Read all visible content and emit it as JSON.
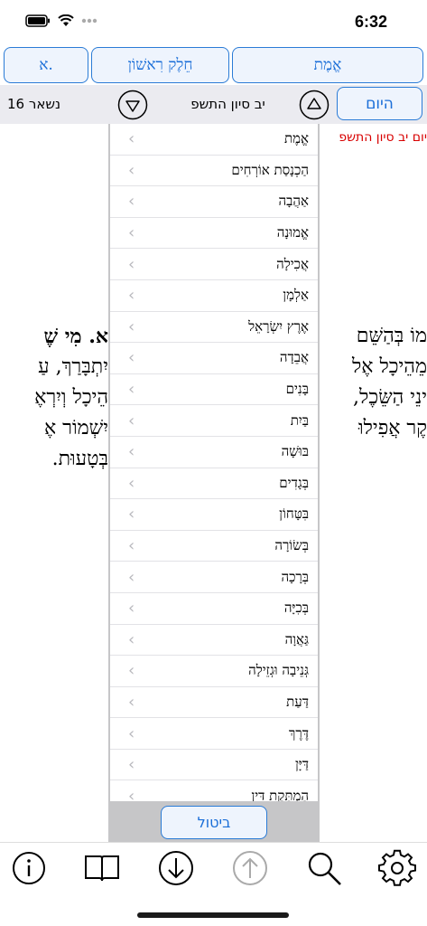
{
  "status": {
    "time": "6:32"
  },
  "top_buttons": {
    "emet": "אֱמֶת",
    "part": "חֵלֶק רִאשׁוֹן",
    "alef": "א."
  },
  "date_row": {
    "today": "היום",
    "date": "יב סיון התשפ",
    "remaining": "נשאר 16"
  },
  "content": {
    "date_red": "יום יב סיון התשפ",
    "right_lines": [
      "מוֹ בְּהַשֵּׁם",
      "מֵהֵיכָל אֶל",
      "ינֵי הַשֵּׂכֶל,",
      "קֶר אֲפִילוּ"
    ],
    "left_lines": [
      "א. מִי שֶׁ",
      "יִתְבָּרַךְ, עַ",
      "הֵיכָל וְיִרְאֶ",
      "יִשְׁמוֹר אֶ",
      "בְּטָעוּת."
    ]
  },
  "picker": {
    "items": [
      "אֱמֶת",
      "הַכְנָסַת אוֹרְחִים",
      "אַהֲבָה",
      "אֱמוּנָה",
      "אֲכִילָה",
      "אַלְמָן",
      "אֶרֶץ יִשְׂרָאֵל",
      "אֲבֵדָה",
      "בָּנִים",
      "בַּיִת",
      "בּוּשָׁה",
      "בְּגָדִים",
      "בִּטָּחוֹן",
      "בְּשׂוֹרָה",
      "בְּרָכָה",
      "בְּכִיָּה",
      "גַּאֲוָה",
      "גְּנֵיבָה וּגְזֵילָה",
      "דַּעַת",
      "דֶּרֶךְ",
      "דַּיָּן",
      "הַמְתָּקַת דִּין"
    ],
    "cancel": "ביטול"
  },
  "toolbar": {
    "icons": [
      "info-icon",
      "book-icon",
      "arrow-down-circle-icon",
      "arrow-up-circle-icon",
      "search-icon",
      "gear-icon"
    ]
  },
  "colors": {
    "accent": "#1a6ed8",
    "accent_bg": "#eef4fd",
    "red_text": "#d80000",
    "overlay_gray": "#c6c6c8"
  }
}
